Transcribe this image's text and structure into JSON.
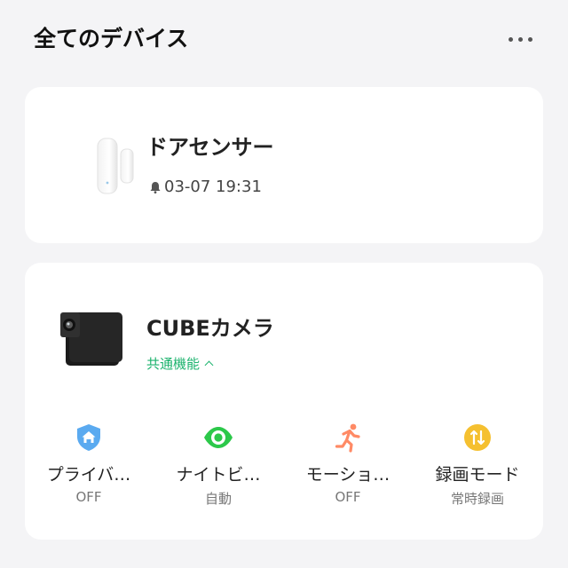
{
  "header": {
    "title": "全てのデバイス",
    "more_icon": "more-horizontal-icon"
  },
  "devices": [
    {
      "name": "ドアセンサー",
      "image_icon": "door-sensor-image",
      "status_icon": "bell-icon",
      "status_time": "03-07 19:31"
    },
    {
      "name": "CUBEカメラ",
      "image_icon": "cube-camera-image",
      "shared_label": "共通機能",
      "shared_icon": "chevron-up-icon",
      "features": [
        {
          "label": "プライバ…",
          "value": "OFF",
          "icon": "home-shield-icon",
          "color": "#5aaaf0"
        },
        {
          "label": "ナイトビ…",
          "value": "自動",
          "icon": "eye-icon",
          "color": "#2cc84a"
        },
        {
          "label": "モーショ…",
          "value": "OFF",
          "icon": "running-person-icon",
          "color": "#ff8a65"
        },
        {
          "label": "録画モード",
          "value": "常時録画",
          "icon": "record-mode-icon",
          "color": "#f5c030"
        }
      ]
    }
  ],
  "colors": {
    "background": "#f4f4f6",
    "card": "#ffffff",
    "accent_green": "#1db36e"
  }
}
